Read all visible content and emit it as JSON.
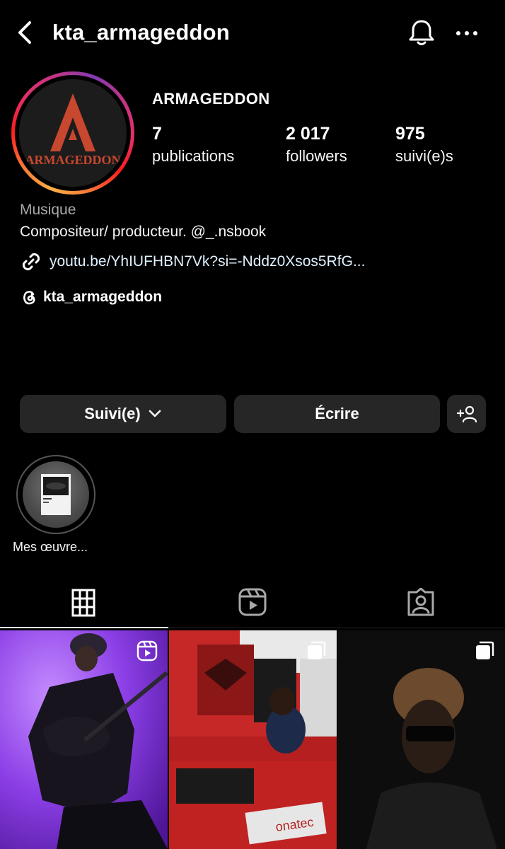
{
  "header": {
    "username": "kta_armageddon",
    "back_icon": "chevron-left-icon",
    "notifications_icon": "bell-icon",
    "more_icon": "ellipsis-icon"
  },
  "profile": {
    "avatar_logo_text": "ARMAGEDDON",
    "avatar_logo_letter": "A",
    "display_name": "ARMAGEDDON",
    "stats": [
      {
        "value": "7",
        "label": "publications"
      },
      {
        "value": "2 017",
        "label": "followers"
      },
      {
        "value": "975",
        "label": "suivi(e)s"
      }
    ],
    "category": "Musique",
    "bio": "Compositeur/ producteur. @_.nsbook",
    "link": "youtu.be/YhIUFHBN7Vk?si=-Nddz0Xsos5RfG...",
    "threads_handle": "kta_armageddon"
  },
  "actions": {
    "follow_label": "Suivi(e)",
    "message_label": "Écrire",
    "suggest_icon": "add-person-icon"
  },
  "highlights": [
    {
      "label": "Mes œuvre..."
    }
  ],
  "tabs": [
    {
      "name": "posts",
      "icon": "grid-icon",
      "active": true
    },
    {
      "name": "reels",
      "icon": "reels-icon",
      "active": false
    },
    {
      "name": "tagged",
      "icon": "tagged-icon",
      "active": false
    }
  ],
  "posts": [
    {
      "type": "reel",
      "badge_icon": "reels-icon",
      "scene": "guitarist in purple light"
    },
    {
      "type": "carousel",
      "badge_icon": "multiple-posts-icon",
      "scene": "radio studio",
      "visible_text": "onatec"
    },
    {
      "type": "carousel",
      "badge_icon": "multiple-posts-icon",
      "scene": "portrait with sunglasses"
    }
  ],
  "colors": {
    "background": "#000000",
    "button_bg": "#262626",
    "secondary_text": "#a8a8a8",
    "link_text": "#e0f1ff",
    "logo_red": "#c8472f"
  }
}
